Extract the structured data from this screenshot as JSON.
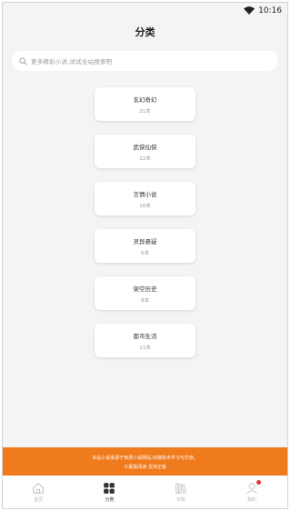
{
  "status_bar": {
    "time": "10:16",
    "wifi_icon": "wifi-icon"
  },
  "header": {
    "title": "分类"
  },
  "search": {
    "icon": "search-icon",
    "placeholder": "更多精彩小说,试试全站搜索吧"
  },
  "categories": [
    {
      "name": "玄幻奇幻",
      "count": "21本"
    },
    {
      "name": "武侠仙侠",
      "count": "22本"
    },
    {
      "name": "言情小说",
      "count": "16本"
    },
    {
      "name": "灵异悬疑",
      "count": "6本"
    },
    {
      "name": "架空历史",
      "count": "8本"
    },
    {
      "name": "都市生活",
      "count": "11本"
    }
  ],
  "banner": {
    "line1": "本站小说来源于免费小说网站,仅做技术学习与交流。",
    "line2": "©掘笔阅读 支持正版"
  },
  "tab_bar": {
    "items": [
      {
        "label": "首页",
        "icon": "home-icon",
        "active": false
      },
      {
        "label": "分类",
        "icon": "grid-icon",
        "active": true
      },
      {
        "label": "书架",
        "icon": "bookshelf-icon",
        "active": false
      },
      {
        "label": "我的",
        "icon": "user-icon",
        "active": false,
        "badge": true
      }
    ]
  },
  "colors": {
    "accent": "#f07b1d",
    "badge": "#e53935",
    "background": "#f4f4f4"
  }
}
